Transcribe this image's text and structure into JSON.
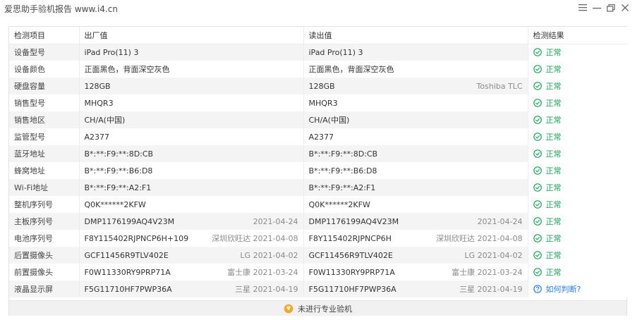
{
  "window": {
    "title": "爱思助手验机报告 www.i4.cn"
  },
  "colors": {
    "ok": "#1aa35a",
    "link": "#2a7de1",
    "badge": "#f5a623"
  },
  "table": {
    "headers": [
      "检测项目",
      "出厂值",
      "读出值",
      "检测结果"
    ],
    "rows": [
      {
        "item": "设备型号",
        "factory": "iPad Pro(11) 3",
        "factory_meta": "",
        "read": "iPad Pro(11) 3",
        "read_meta": "",
        "result": "正常"
      },
      {
        "item": "设备颜色",
        "factory": "正面黑色，背面深空灰色",
        "factory_meta": "",
        "read": "正面黑色，背面深空灰色",
        "read_meta": "",
        "result": "正常"
      },
      {
        "item": "硬盘容量",
        "factory": "128GB",
        "factory_meta": "",
        "read": "128GB",
        "read_meta": "Toshiba TLC",
        "result": "正常"
      },
      {
        "item": "销售型号",
        "factory": "MHQR3",
        "factory_meta": "",
        "read": "MHQR3",
        "read_meta": "",
        "result": "正常"
      },
      {
        "item": "销售地区",
        "factory": "CH/A(中国)",
        "factory_meta": "",
        "read": "CH/A(中国)",
        "read_meta": "",
        "result": "正常"
      },
      {
        "item": "监管型号",
        "factory": "A2377",
        "factory_meta": "",
        "read": "A2377",
        "read_meta": "",
        "result": "正常"
      },
      {
        "item": "蓝牙地址",
        "factory": "B*:**:F9:**:8D:CB",
        "factory_meta": "",
        "read": "B*:**:F9:**:8D:CB",
        "read_meta": "",
        "result": "正常"
      },
      {
        "item": "蜂窝地址",
        "factory": "B*:**:F9:**:B6:D8",
        "factory_meta": "",
        "read": "B*:**:F9:**:B6:D8",
        "read_meta": "",
        "result": "正常"
      },
      {
        "item": "Wi-Fi地址",
        "factory": "B*:**:F9:**:A2:F1",
        "factory_meta": "",
        "read": "B*:**:F9:**:A2:F1",
        "read_meta": "",
        "result": "正常"
      },
      {
        "item": "整机序列号",
        "factory": "Q0K******2KFW",
        "factory_meta": "",
        "read": "Q0K******2KFW",
        "read_meta": "",
        "result": "正常"
      },
      {
        "item": "主板序列号",
        "factory": "DMP1176199AQ4V23M",
        "factory_meta": "2021-04-24",
        "read": "DMP1176199AQ4V23M",
        "read_meta": "2021-04-24",
        "result": "正常"
      },
      {
        "item": "电池序列号",
        "factory": "F8Y115402RJPNCP6H+109",
        "factory_meta": "深圳欣旺达 2021-04-08",
        "read": "F8Y115402RJPNCP6H",
        "read_meta": "深圳欣旺达 2021-04-08",
        "result": "正常"
      },
      {
        "item": "后置摄像头",
        "factory": "GCF11456R9TLV402E",
        "factory_meta": "LG 2021-04-02",
        "read": "GCF11456R9TLV402E",
        "read_meta": "LG 2021-04-02",
        "result": "正常"
      },
      {
        "item": "前置摄像头",
        "factory": "F0W11330RY9PRP71A",
        "factory_meta": "富士康 2021-03-24",
        "read": "F0W11330RY9PRP71A",
        "read_meta": "富士康 2021-03-24",
        "result": "正常"
      },
      {
        "item": "液晶显示屏",
        "factory": "F5G11710HF7PWP36A",
        "factory_meta": "三星 2021-04-19",
        "read": "F5G11710HF7PWP36A",
        "read_meta": "三星 2021-04-19",
        "result": "如何判断?",
        "result_type": "help"
      }
    ]
  },
  "footer": {
    "text": "未进行专业验机"
  },
  "icons": {
    "ok": "check-circle-icon",
    "help": "question-circle-icon",
    "badge": "shield-badge-icon"
  }
}
